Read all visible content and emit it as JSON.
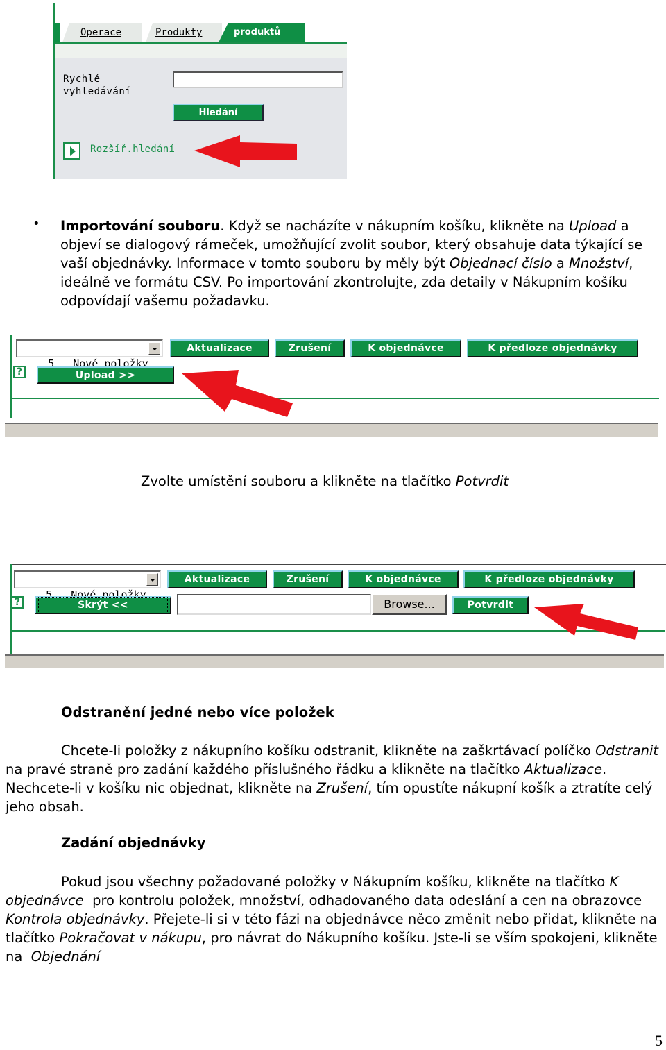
{
  "search_panel": {
    "tabs": [
      {
        "label": "Operace",
        "active": false
      },
      {
        "label": "Produkty",
        "active": false
      },
      {
        "label": "produktů",
        "active": true
      }
    ],
    "quick_search_label_line1": "Rychlé",
    "quick_search_label_line2": "vyhledávání",
    "quick_search_value": "",
    "search_button": "Hledání",
    "advanced_search_link": "Rozšíř.hledání"
  },
  "import_section": {
    "bullet": "•",
    "title": "Importování souboru",
    "text_1": ". Když se nacházíte v nákupním košíku, klikněte na ",
    "upload_term": "Upload",
    "text_2": " a objeví se dialogový rámeček, umožňující zvolit soubor, který obsahuje data týkající se vaší objednávky. Informace v tomto souboru by měly být ",
    "order_number_term": "Objednací číslo",
    "text_3": " a ",
    "quantity_term": "Množství",
    "text_4": ", ideálně ve formátu CSV. Po importování zkontrolujte, zda detaily v Nákupním košíku odpovídají vašemu požadavku."
  },
  "cart_toolbar_1": {
    "select_value": "5   Nové položky",
    "buttons": [
      "Aktualizace",
      "Zrušení",
      "K objednávce",
      "K předloze objednávky"
    ],
    "help_icon": "?",
    "upload_button": "Upload >>"
  },
  "caption": {
    "text": "Zvolte umístění souboru a klikněte na tlačítko ",
    "term": "Potvrdit"
  },
  "cart_toolbar_2": {
    "select_value": "5   Nové položky",
    "buttons": [
      "Aktualizace",
      "Zrušení",
      "K objednávce",
      "K předloze objednávky"
    ],
    "help_icon": "?",
    "hide_button": "Skrýt <<",
    "file_value": "",
    "browse_button": "Browse...",
    "confirm_button": "Potvrdit"
  },
  "remove_section": {
    "heading": "Odstranění jedné nebo více položek",
    "t1": "Chcete-li položky z nákupního košíku odstranit, klikněte na zaškrtávací políčko ",
    "i1": "Odstranit",
    "t2": " na pravé straně pro zadání každého příslušného řádku a klikněte na tlačítko ",
    "i2": "Aktualizace",
    "t3": ". Nechcete-li v košíku nic objednat, klikněte na ",
    "i3": "Zrušení",
    "t4": ", tím opustíte nákupní košík a ztratíte celý jeho obsah."
  },
  "order_section": {
    "heading": "Zadání objednávky",
    "t1": "Pokud jsou všechny požadované položky v Nákupním košíku, klikněte na tlačítko ",
    "i1": "K objednávce",
    "t2": "  pro kontrolu položek, množství, odhadovaného data odeslání a cen na obrazovce ",
    "i2": "Kontrola objednávky",
    "t3": ". Přejete-li si v této fázi na objednávce něco změnit nebo přidat, klikněte na tlačítko ",
    "i3": "Pokračovat v nákupu",
    "t4": ", pro návrat do Nákupního košíku. Jste-li se vším spokojeni, klikněte na  ",
    "i4": "Objednání"
  },
  "page_number": "5",
  "colors": {
    "brand_green": "#0f8f45",
    "arrow_red": "#e8141c",
    "panel_grey": "#e4e6ea"
  }
}
